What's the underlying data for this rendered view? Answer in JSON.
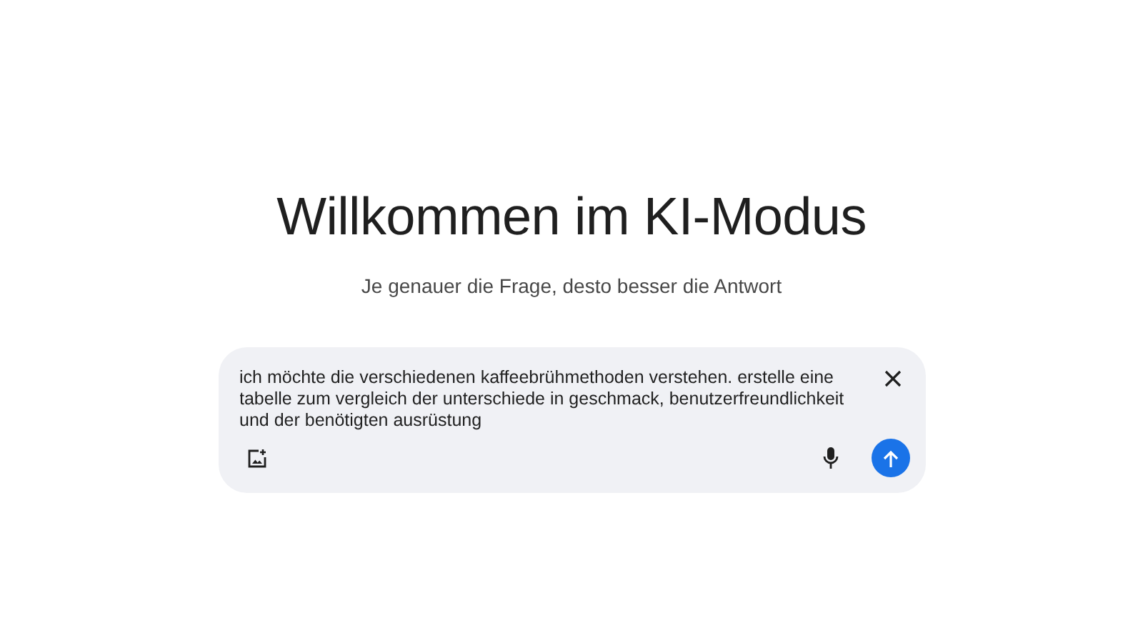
{
  "heading": "Willkommen im KI-Modus",
  "subheading": "Je genauer die Frage, desto besser die Antwort",
  "prompt": {
    "value": "ich möchte die verschiedenen kaffeebrühmethoden verstehen. erstelle eine tabelle zum vergleich der unterschiede in geschmack, benutzerfreundlichkeit und der benötigten ausrüstung"
  }
}
